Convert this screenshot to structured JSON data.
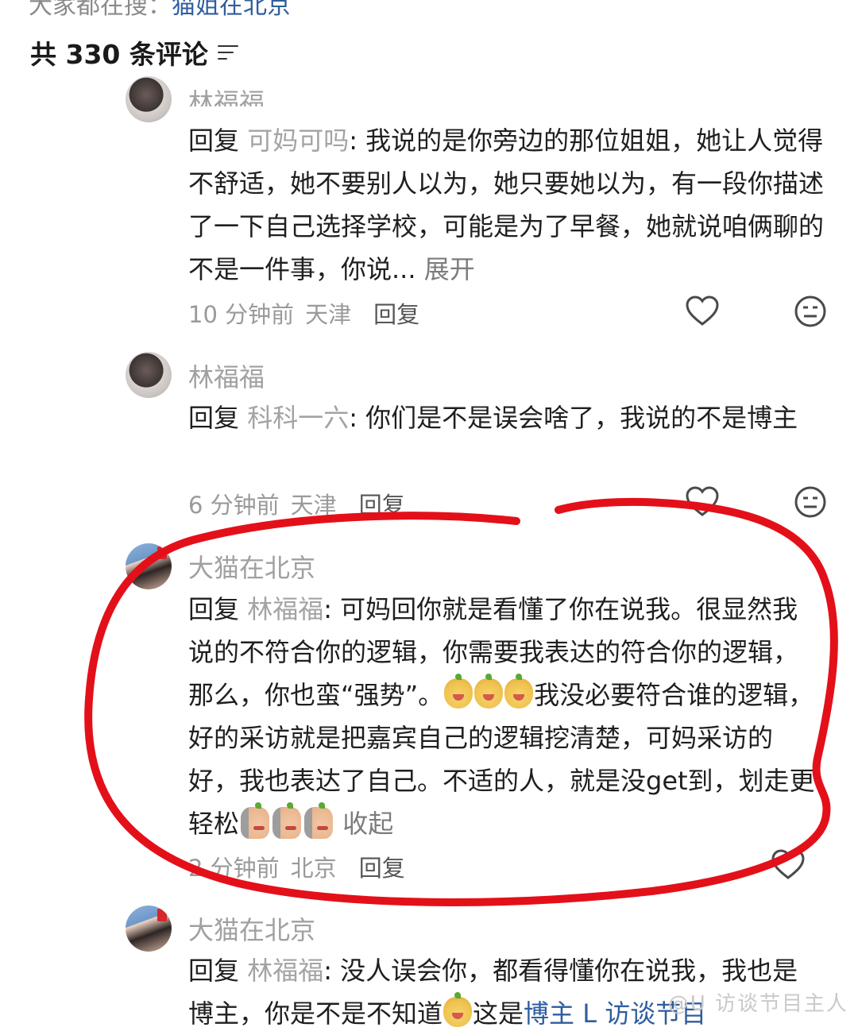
{
  "top_search": {
    "prefix": "大家都在搜：",
    "keyword": "猫姐在北京"
  },
  "comments_header": {
    "title": "共 330 条评论"
  },
  "comments": [
    {
      "username": "林福福",
      "reply_label": "回复 ",
      "reply_to": "可妈可吗",
      "text": ": 我说的是你旁边的那位姐姐，她让人觉得不舒适，她不要别人以为，她只要她以为，有一段你描述了一下自己选择学校，可能是为了早餐，她就说咱俩聊的不是一件事，你说...",
      "expand_label": " 展开",
      "time": "10 分钟前",
      "location": "天津",
      "reply_button": "回复"
    },
    {
      "username": "林福福",
      "reply_label": "回复 ",
      "reply_to": "科科一六",
      "text": ": 你们是不是误会啥了，我说的不是博主",
      "time": "6 分钟前",
      "location": "天津",
      "reply_button": "回复"
    },
    {
      "username": "大猫在北京",
      "reply_label": "回复 ",
      "reply_to": "林福福",
      "text_a": ": 可妈回你就是看懂了你在说我。很显然我说的不符合你的逻辑，你需要我表达的符合你的逻辑，那么，你也蛮“强势”。",
      "text_b": "我没必要符合谁的逻辑，好的采访就是把嘉宾自己的逻辑挖清楚，可妈采访的好，我也表达了自己。不适的人，就是没get到，划走更轻松",
      "collapse_label": " 收起",
      "time": "2 分钟前",
      "location": "北京",
      "reply_button": "回复"
    },
    {
      "username": "大猫在北京",
      "reply_label": "回复 ",
      "reply_to": "林福福",
      "text_a": ": 没人误会你，都看得懂你在说我，我也是博主，你是不是不知道",
      "text_b": "这是",
      "link_text": "博主 L 访谈节目"
    }
  ],
  "watermark": "@U 访谈节目主人",
  "icons": {
    "like": "heart-outline-icon",
    "dislike": "neutral-face-icon",
    "sort": "sort-lines-icon"
  },
  "annotation_color": "#e3101a"
}
